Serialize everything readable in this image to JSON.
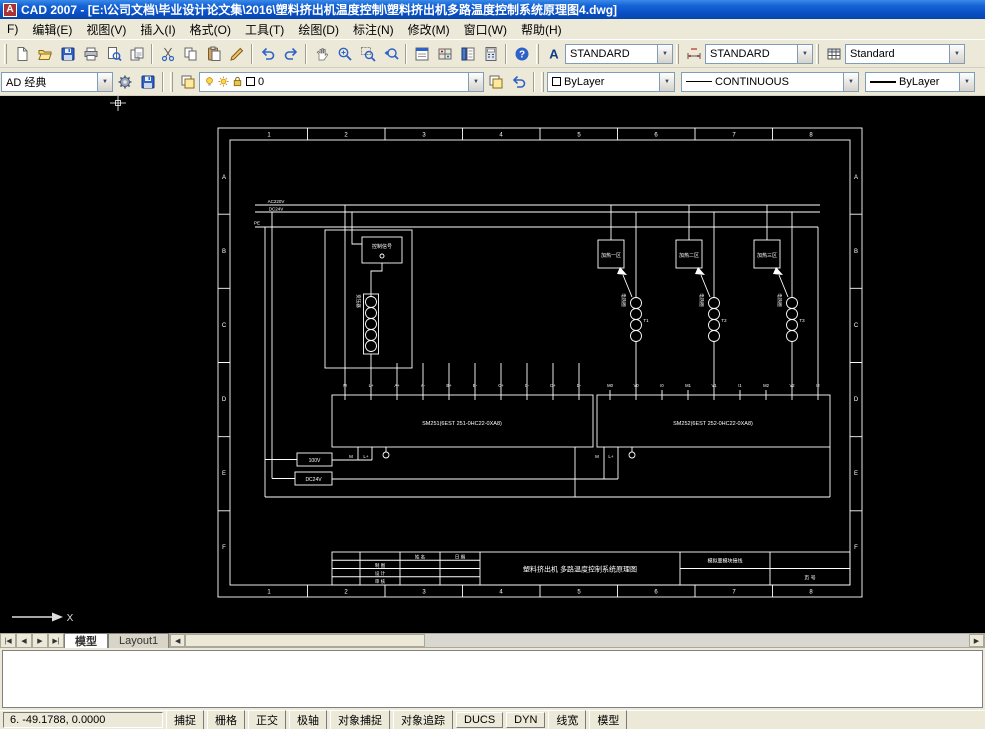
{
  "titlebar": {
    "title": "CAD 2007 - [E:\\公司文档\\毕业设计论文集\\2016\\塑料挤出机温度控制\\塑料挤出机多路温度控制系统原理图4.dwg]"
  },
  "menubar": {
    "items": [
      "F)",
      "编辑(E)",
      "视图(V)",
      "插入(I)",
      "格式(O)",
      "工具(T)",
      "绘图(D)",
      "标注(N)",
      "修改(M)",
      "窗口(W)",
      "帮助(H)"
    ]
  },
  "toolbars": {
    "text_style": "STANDARD",
    "dim_style": "STANDARD",
    "table_style": "Standard",
    "workspace": "AD 经典",
    "layer": "0",
    "color": "ByLayer",
    "linetype": "CONTINUOUS",
    "lineweight": "ByLayer",
    "dropdown_arrow": "▼"
  },
  "drawing": {
    "zone_cols": [
      "1",
      "2",
      "3",
      "4",
      "5",
      "6",
      "7",
      "8"
    ],
    "zone_rows": [
      "A",
      "B",
      "C",
      "D",
      "E",
      "F"
    ],
    "bus_ac": "AC220V",
    "bus_dc": "DC24V",
    "bus_pe": "PE",
    "control_box": "控制信号",
    "transformer_label": "变压器",
    "zones": [
      {
        "box": "加热一区",
        "coil": "电热圈",
        "tag": "T1"
      },
      {
        "box": "加热二区",
        "coil": "电热圈",
        "tag": "T2"
      },
      {
        "box": "加热三区",
        "coil": "电热圈",
        "tag": "T3"
      }
    ],
    "module1": "SM251(6EST 251-0HC22-0XA8)",
    "module2": "SM252(6EST 252-0HC22-0XA8)",
    "m1_terms": [
      "M",
      "L+",
      "A+",
      "A-",
      "B+",
      "B-",
      "C+",
      "C-",
      "D+",
      "D-"
    ],
    "m2_terms": [
      "M0",
      "V0",
      "I0",
      "M1",
      "V1",
      "I1",
      "M2",
      "V2",
      "I2"
    ],
    "pwr_m": "M",
    "pwr_l": "L+",
    "supply1": "100V",
    "supply2": "DC24V",
    "ucs_x": "X",
    "titleblock": {
      "col_name": "姓 名",
      "col_date": "日 期",
      "rows": [
        "制 图",
        "设 计",
        "审 核"
      ],
      "title": "塑料挤出机 多路温度控制系统原理图",
      "right_top": "模拟量模块接线",
      "right_bottom": "页 号"
    }
  },
  "tabs": {
    "model": "模型",
    "layout": "Layout1"
  },
  "statusbar": {
    "coords": "6. -49.1788,  0.0000",
    "toggles": [
      "捕捉",
      "栅格",
      "正交",
      "极轴",
      "对象捕捉",
      "对象追踪",
      "DUCS",
      "DYN",
      "线宽",
      "模型"
    ]
  }
}
